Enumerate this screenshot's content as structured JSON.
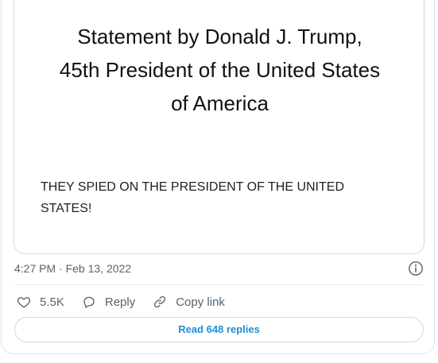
{
  "statement": {
    "title_lines": [
      "Statement by Donald J. Trump,",
      "45th President of the United States",
      "of America"
    ],
    "body_lines": [
      "THEY SPIED ON THE PRESIDENT OF THE UNITED",
      "STATES!"
    ]
  },
  "meta": {
    "timestamp": "4:27 PM · Feb 13, 2022",
    "info_icon": "info-circle-icon"
  },
  "actions": {
    "like_icon": "heart-icon",
    "like_count": "5.5K",
    "reply_icon": "speech-bubble-icon",
    "reply_label": "Reply",
    "copy_icon": "link-icon",
    "copy_label": "Copy link"
  },
  "replies_button": {
    "label": "Read 648 replies"
  },
  "colors": {
    "accent": "#1d8fd6",
    "muted_text": "#536471",
    "border": "#cfd9de"
  }
}
